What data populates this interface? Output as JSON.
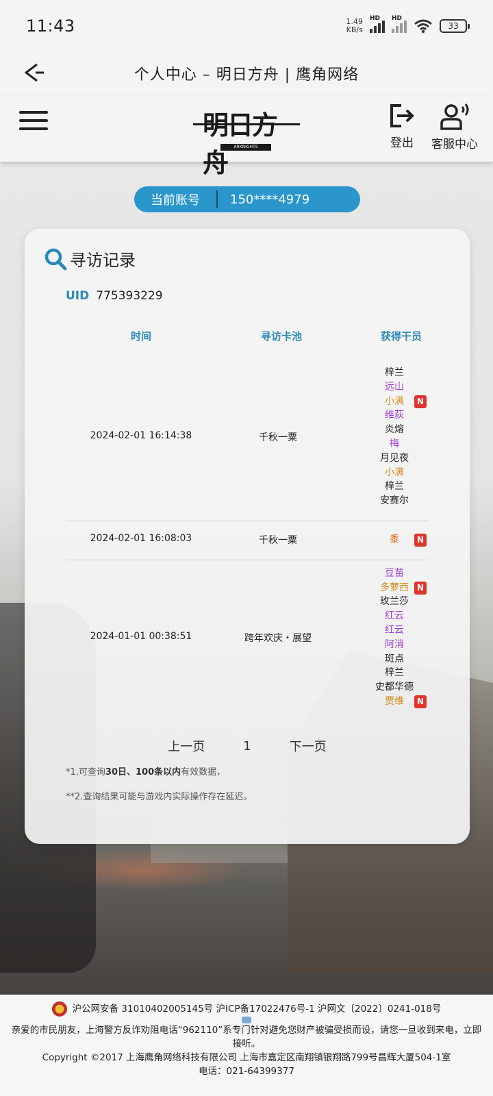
{
  "status_bar": {
    "time": "11:43",
    "net_speed_value": "1.49",
    "net_speed_unit": "KB/s",
    "signal_1_label": "HD",
    "signal_2_label": "HD",
    "battery": "33"
  },
  "title_bar": {
    "title": "个人中心 – 明日方舟 | 鹰角网络"
  },
  "header": {
    "logo_text": "明日方舟",
    "logo_sub": "ARKNIGHTS",
    "logout_label": "登出",
    "support_label": "客服中心"
  },
  "account": {
    "label": "当前账号",
    "value": "150****4979"
  },
  "card": {
    "title": "寻访记录",
    "uid_label": "UID",
    "uid_value": "775393229",
    "columns": {
      "time": "时间",
      "pool": "寻访卡池",
      "operators": "获得干员"
    },
    "records": [
      {
        "time": "2024-02-01 16:14:38",
        "pool": "千秋一粟",
        "operators": [
          {
            "name": "梓兰",
            "color": "#222222",
            "new": false
          },
          {
            "name": "远山",
            "color": "#a23fd4",
            "new": false
          },
          {
            "name": "小满",
            "color": "#d48a1c",
            "new": true
          },
          {
            "name": "维荻",
            "color": "#a23fd4",
            "new": false
          },
          {
            "name": "炎熔",
            "color": "#222222",
            "new": false
          },
          {
            "name": "梅",
            "color": "#a23fd4",
            "new": false
          },
          {
            "name": "月见夜",
            "color": "#222222",
            "new": false
          },
          {
            "name": "小满",
            "color": "#d48a1c",
            "new": false
          },
          {
            "name": "梓兰",
            "color": "#222222",
            "new": false
          },
          {
            "name": "安赛尔",
            "color": "#222222",
            "new": false
          }
        ]
      },
      {
        "time": "2024-02-01 16:08:03",
        "pool": "千秋一粟",
        "operators": [
          {
            "name": "黍",
            "color": "#e06a1a",
            "new": true
          }
        ]
      },
      {
        "time": "2024-01-01 00:38:51",
        "pool": "跨年欢庆・展望",
        "operators": [
          {
            "name": "豆苗",
            "color": "#a23fd4",
            "new": false
          },
          {
            "name": "多萝西",
            "color": "#d48a1c",
            "new": true
          },
          {
            "name": "玫兰莎",
            "color": "#222222",
            "new": false
          },
          {
            "name": "红云",
            "color": "#a23fd4",
            "new": false
          },
          {
            "name": "红云",
            "color": "#a23fd4",
            "new": false
          },
          {
            "name": "阿消",
            "color": "#a23fd4",
            "new": false
          },
          {
            "name": "斑点",
            "color": "#222222",
            "new": false
          },
          {
            "name": "梓兰",
            "color": "#222222",
            "new": false
          },
          {
            "name": "史都华德",
            "color": "#222222",
            "new": false
          },
          {
            "name": "贾维",
            "color": "#d48a1c",
            "new": true
          }
        ]
      }
    ],
    "new_badge": "N",
    "pager": {
      "prev": "上一页",
      "current": "1",
      "next": "下一页"
    },
    "note1_prefix": "*1.可查询",
    "note1_bold": "30日、100条以内",
    "note1_suffix": "有效数据，",
    "note2": "**2.查询结果可能与游戏内实际操作存在延迟。"
  },
  "footer": {
    "line1": "沪公网安备 31010402005145号  沪ICP备17022476号-1  沪网文〔2022〕0241-018号",
    "line2": "亲爱的市民朋友，上海警方反诈劝阻电话“962110”系专门针对避免您财产被骗受损而设，请您一旦收到来电，立即接听。",
    "line3": "Copyright ©2017 上海鹰角网络科技有限公司  上海市嘉定区南翔镇银翔路799号昌辉大厦504-1室",
    "line4": "电话：021-64399377"
  }
}
